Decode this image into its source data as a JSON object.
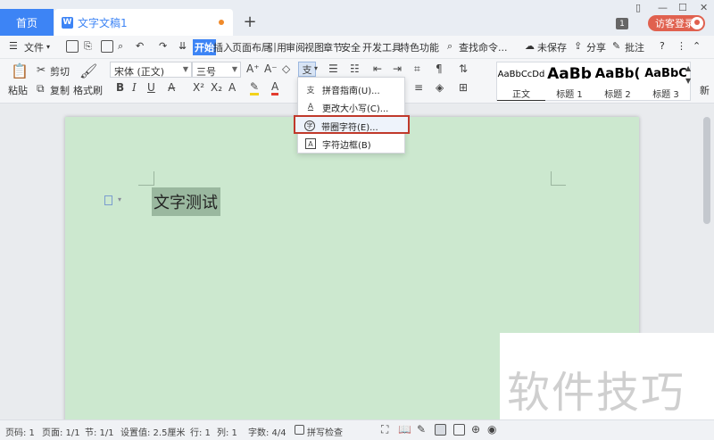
{
  "tabs": {
    "home": "首页",
    "doc_title": "文字文稿1",
    "add": "+"
  },
  "window": {
    "badge": "1",
    "login": "访客登录"
  },
  "menubar": {
    "file": "文件",
    "items": [
      "开始",
      "插入",
      "页面布局",
      "引用",
      "审阅",
      "视图",
      "章节",
      "安全",
      "开发工具",
      "特色功能"
    ],
    "search": "查找命令...",
    "unsaved": "未保存",
    "share": "分享",
    "comment": "批注"
  },
  "ribbon": {
    "paste": "粘贴",
    "cut": "剪切",
    "copy": "复制",
    "format_painter": "格式刷",
    "font_name": "宋体 (正文)",
    "font_size": "三号",
    "styles": [
      {
        "sample": "AaBbCcDd",
        "name": "正文"
      },
      {
        "sample": "AaBb",
        "name": "标题 1"
      },
      {
        "sample": "AaBb(",
        "name": "标题 2"
      },
      {
        "sample": "AaBbC",
        "name": "标题 3"
      }
    ],
    "new_style": "新"
  },
  "dropdown": {
    "items": [
      {
        "icon": "支",
        "label": "拼音指南(U)..."
      },
      {
        "icon": "A",
        "label": "更改大小写(C)..."
      },
      {
        "icon": "字",
        "label": "带圈字符(E)..."
      },
      {
        "icon": "A",
        "label": "字符边框(B)"
      }
    ]
  },
  "document": {
    "selected_text": "文字测试"
  },
  "watermark": "软件技巧",
  "statusbar": {
    "page": "页码: 1",
    "pages": "页面: 1/1",
    "section": "节: 1/1",
    "setting": "设置值: 2.5厘米",
    "row": "行: 1",
    "col": "列: 1",
    "word_count": "字数: 4/4",
    "spell_check": "拼写检查"
  }
}
